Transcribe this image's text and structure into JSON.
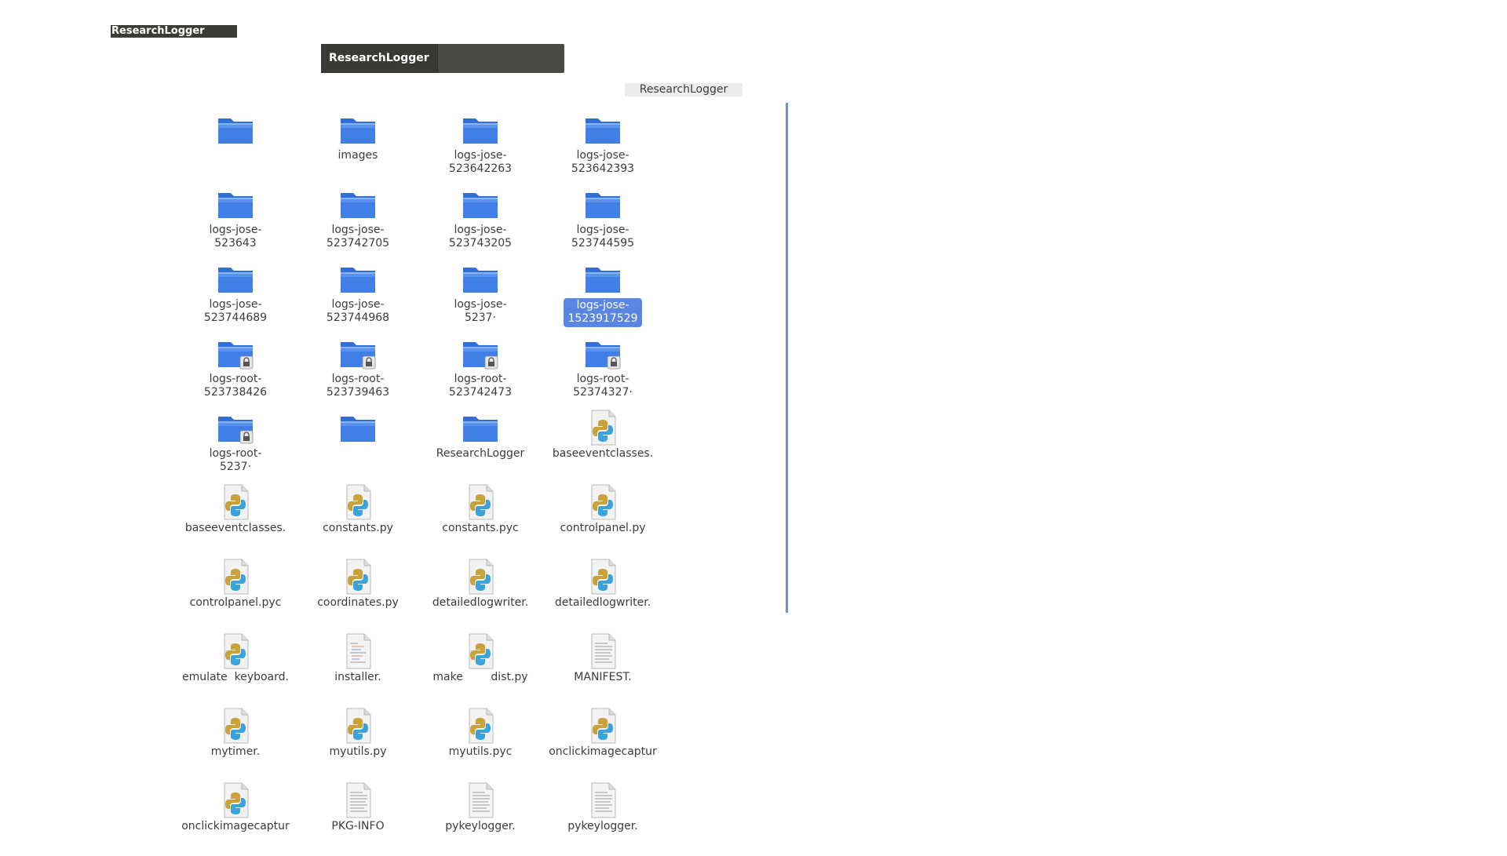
{
  "window": {
    "title": "ResearchLogger"
  },
  "tabs": [
    {
      "label": "ResearchLogger"
    }
  ],
  "path": {
    "current": "ResearchLogger"
  },
  "files": [
    {
      "name": "",
      "type": "folder"
    },
    {
      "name": "images",
      "type": "folder"
    },
    {
      "name": "logs-jose-\n523642263",
      "type": "folder"
    },
    {
      "name": "logs-jose-\n523642393",
      "type": "folder"
    },
    {
      "name": "logs-jose-\n523643",
      "type": "folder"
    },
    {
      "name": "logs-jose-\n523742705",
      "type": "folder"
    },
    {
      "name": "logs-jose-\n523743205",
      "type": "folder"
    },
    {
      "name": "logs-jose-\n523744595",
      "type": "folder"
    },
    {
      "name": "logs-jose-\n523744689",
      "type": "folder"
    },
    {
      "name": "logs-jose-\n523744968",
      "type": "folder"
    },
    {
      "name": "logs-jose-\n5237·",
      "type": "folder"
    },
    {
      "name": "logs-jose-\n1523917529",
      "type": "folder",
      "selected": true
    },
    {
      "name": "logs-root-\n523738426",
      "type": "locked-folder"
    },
    {
      "name": "logs-root-\n523739463",
      "type": "locked-folder"
    },
    {
      "name": "logs-root-\n523742473",
      "type": "locked-folder"
    },
    {
      "name": "logs-root-\n52374327·",
      "type": "locked-folder"
    },
    {
      "name": "logs-root-\n5237·",
      "type": "locked-folder"
    },
    {
      "name": "",
      "type": "folder"
    },
    {
      "name": "ResearchLogger",
      "type": "folder"
    },
    {
      "name": "baseeventclasses.",
      "type": "python"
    },
    {
      "name": "baseeventclasses.",
      "type": "python"
    },
    {
      "name": "constants.py",
      "type": "python"
    },
    {
      "name": "constants.pyc",
      "type": "python"
    },
    {
      "name": "controlpanel.py",
      "type": "python"
    },
    {
      "name": "controlpanel.pyc",
      "type": "python"
    },
    {
      "name": "coordinates.py",
      "type": "python"
    },
    {
      "name": "detailedlogwriter.",
      "type": "python"
    },
    {
      "name": "detailedlogwriter.",
      "type": "python"
    },
    {
      "name": "emulate  keyboard.",
      "type": "python"
    },
    {
      "name": "installer.",
      "type": "script"
    },
    {
      "name": "make        dist.py",
      "type": "python"
    },
    {
      "name": "MANIFEST.",
      "type": "text"
    },
    {
      "name": "mytimer.",
      "type": "python"
    },
    {
      "name": "myutils.py",
      "type": "python"
    },
    {
      "name": "myutils.pyc",
      "type": "python"
    },
    {
      "name": "onclickimagecaptur",
      "type": "python"
    },
    {
      "name": "onclickimagecaptur",
      "type": "python"
    },
    {
      "name": "PKG-INFO",
      "type": "text"
    },
    {
      "name": "pykeylogger.",
      "type": "text"
    },
    {
      "name": "pykeylogger.",
      "type": "text"
    }
  ],
  "colors": {
    "folder": "#3f7fe6",
    "selection": "#5a86e3",
    "titlebar": "#3c3b37",
    "scrollbar": "#6d8fe0"
  }
}
